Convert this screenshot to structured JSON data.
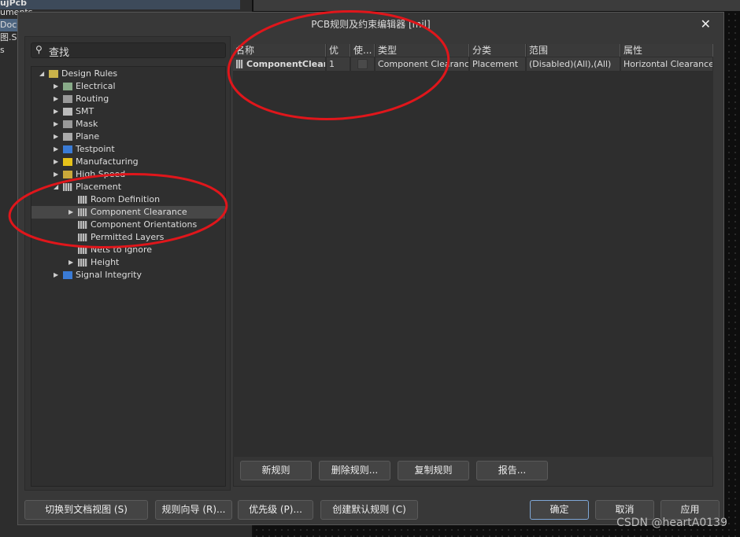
{
  "background": {
    "items": [
      "ujPcb",
      "uments",
      "Doc",
      "图.SC",
      "s"
    ]
  },
  "dialog": {
    "title": "PCB规则及约束编辑器 [mil]",
    "close_icon": "close-icon"
  },
  "search": {
    "placeholder": "查找",
    "icon": "search-icon"
  },
  "tree": [
    {
      "label": "Design Rules",
      "level": 0,
      "expanded": true
    },
    {
      "label": "Electrical",
      "level": 1
    },
    {
      "label": "Routing",
      "level": 1
    },
    {
      "label": "SMT",
      "level": 1
    },
    {
      "label": "Mask",
      "level": 1
    },
    {
      "label": "Plane",
      "level": 1
    },
    {
      "label": "Testpoint",
      "level": 1
    },
    {
      "label": "Manufacturing",
      "level": 1
    },
    {
      "label": "High Speed",
      "level": 1
    },
    {
      "label": "Placement",
      "level": 1,
      "expanded": true
    },
    {
      "label": "Room Definition",
      "level": 2
    },
    {
      "label": "Component Clearance",
      "level": 2,
      "selected": true,
      "has_children": true
    },
    {
      "label": "Component Orientations",
      "level": 2
    },
    {
      "label": "Permitted Layers",
      "level": 2
    },
    {
      "label": "Nets to Ignore",
      "level": 2
    },
    {
      "label": "Height",
      "level": 2,
      "has_children": true
    },
    {
      "label": "Signal Integrity",
      "level": 1
    }
  ],
  "table": {
    "columns": [
      "名称",
      "优",
      "使...",
      "类型",
      "分类",
      "范围",
      "属性"
    ],
    "rows": [
      [
        "ComponentClearan",
        "1",
        "",
        "Component Clearance",
        "Placement",
        "(Disabled)(All),(All)",
        "Horizontal Clearance ="
      ]
    ]
  },
  "panel_buttons": [
    "新规则",
    "删除规则...",
    "复制规则",
    "报告..."
  ],
  "footer_buttons": [
    "切换到文档视图 (S)",
    "规则向导 (R)...",
    "优先级 (P)...",
    "创建默认规则 (C)"
  ],
  "dialog_buttons": [
    "确定",
    "取消",
    "应用"
  ],
  "watermark": "CSDN @heartA0139",
  "colors": {
    "annotation": "#e0161b",
    "accent": "#7fa7d6"
  }
}
